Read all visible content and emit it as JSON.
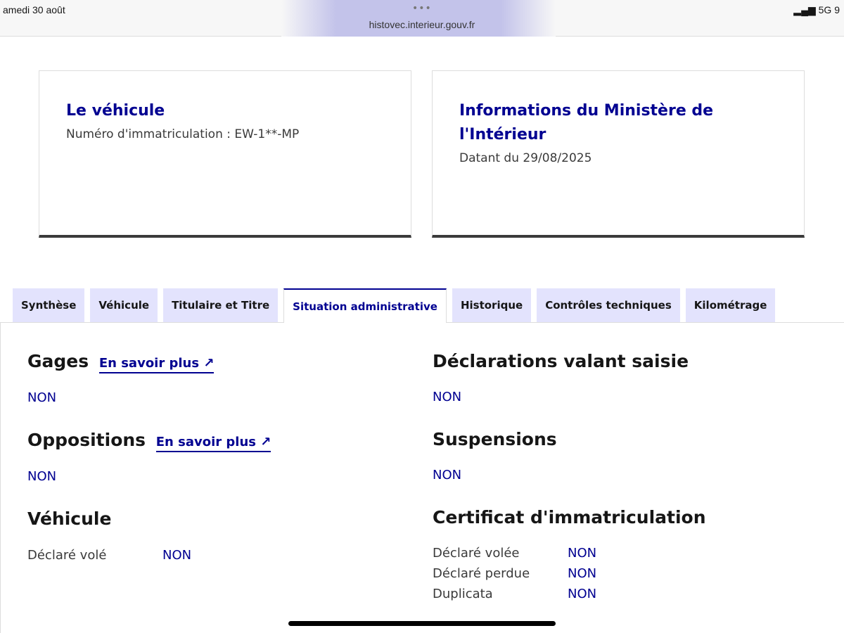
{
  "status": {
    "date": "amedi 30 août",
    "url": "histovec.interieur.gouv.fr",
    "signal": "5G 9"
  },
  "cards": [
    {
      "title": "Le véhicule",
      "text": "Numéro d'immatriculation : EW-1**-MP"
    },
    {
      "title": "Informations du Ministère de l'Intérieur",
      "text": "Datant du 29/08/2025"
    }
  ],
  "tabs": [
    "Synthèse",
    "Véhicule",
    "Titulaire et Titre",
    "Situation administrative",
    "Historique",
    "Contrôles techniques",
    "Kilométrage"
  ],
  "link": "En savoir plus",
  "left": {
    "gages": "Gages",
    "gages_v": "NON",
    "opp": "Oppositions",
    "opp_v": "NON",
    "veh": "Véhicule",
    "vole": "Déclaré volé",
    "vole_v": "NON"
  },
  "right": {
    "decl": "Déclarations valant saisie",
    "decl_v": "NON",
    "susp": "Suspensions",
    "susp_v": "NON",
    "cert": "Certificat d'immatriculation",
    "rows": [
      {
        "l": "Déclaré volée",
        "v": "NON"
      },
      {
        "l": "Déclaré perdue",
        "v": "NON"
      },
      {
        "l": "Duplicata",
        "v": "NON"
      }
    ]
  }
}
